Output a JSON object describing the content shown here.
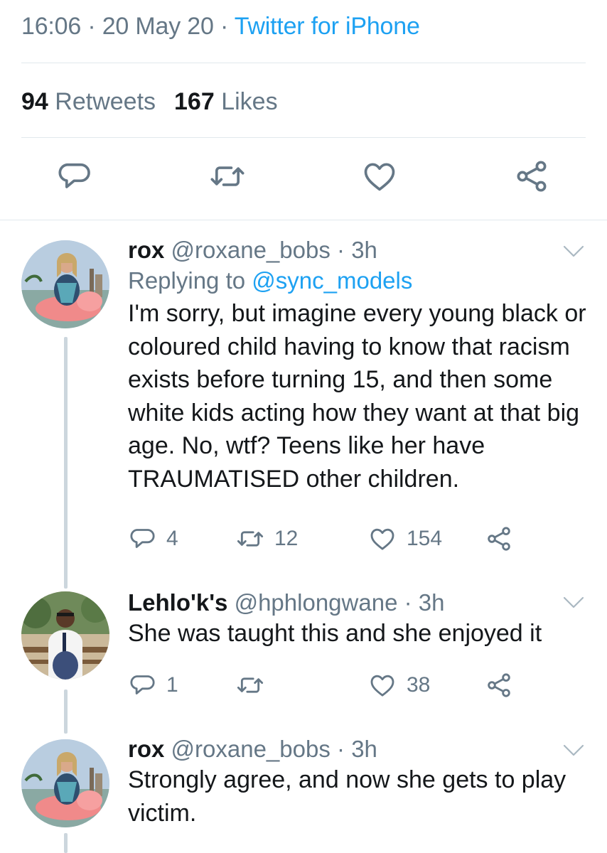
{
  "tweet": {
    "time": "16:06",
    "date": "20 May 20",
    "source": "Twitter for iPhone",
    "retweets_count": "94",
    "retweets_label": "Retweets",
    "likes_count": "167",
    "likes_label": "Likes"
  },
  "separator": "·",
  "replies": [
    {
      "name": "rox",
      "handle": "@roxane_bobs",
      "age": "3h",
      "replying_label": "Replying to",
      "replying_to": "@sync_models",
      "text": "I'm sorry, but imagine every young black or coloured child having to know that racism exists before turning 15, and then some white kids acting how they want at that big age. No, wtf? Teens like her have TRAUMATISED other children.",
      "reply_count": "4",
      "retweet_count": "12",
      "like_count": "154"
    },
    {
      "name": "Lehlo'k's",
      "handle": "@hphlongwane",
      "age": "3h",
      "text": "She was taught this and she enjoyed it",
      "reply_count": "1",
      "retweet_count": "",
      "like_count": "38"
    },
    {
      "name": "rox",
      "handle": "@roxane_bobs",
      "age": "3h",
      "text": "Strongly agree, and now she gets to play victim."
    }
  ],
  "icons": {
    "reply": "reply-icon",
    "retweet": "retweet-icon",
    "like": "heart-icon",
    "share": "share-icon",
    "menu": "chevron-down-icon"
  },
  "colors": {
    "text": "#14171a",
    "secondary": "#657786",
    "accent": "#1da1f2",
    "divider": "#e1e8ed",
    "thread": "#ccd6dd"
  }
}
